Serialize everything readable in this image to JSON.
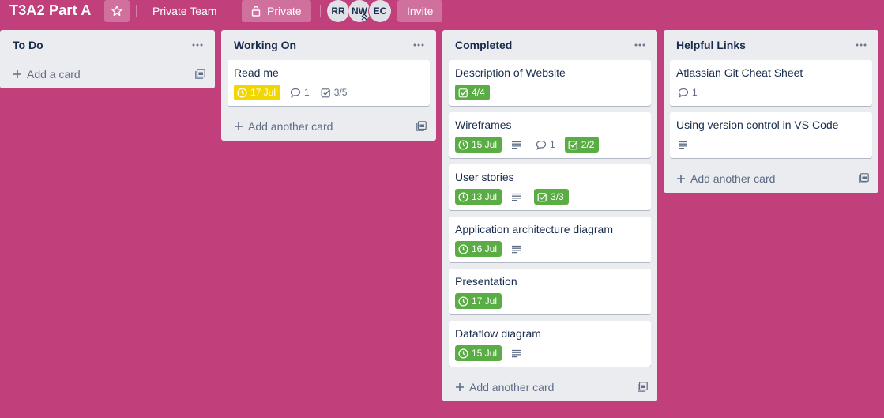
{
  "header": {
    "board_title": "T3A2 Part A",
    "team_label": "Private Team",
    "visibility_label": "Private",
    "invite_label": "Invite",
    "members": [
      "RR",
      "NW",
      "EC"
    ]
  },
  "colors": {
    "board_background": "#c1407c",
    "list_background": "#ebecf0",
    "due_green": "#5aac44",
    "due_yellow": "#f2d600"
  },
  "lists": [
    {
      "title": "To Do",
      "add_label": "Add a card",
      "cards": []
    },
    {
      "title": "Working On",
      "add_label": "Add another card",
      "cards": [
        {
          "title": "Read me",
          "due": "17 Jul",
          "due_status": "yellow",
          "description": false,
          "comments": "1",
          "checklist": "3/5",
          "checklist_complete": false
        }
      ]
    },
    {
      "title": "Completed",
      "add_label": "Add another card",
      "cards": [
        {
          "title": "Description of Website",
          "due": null,
          "description": false,
          "comments": null,
          "checklist": "4/4",
          "checklist_complete": true
        },
        {
          "title": "Wireframes",
          "due": "15 Jul",
          "due_status": "green",
          "description": true,
          "comments": "1",
          "checklist": "2/2",
          "checklist_complete": true
        },
        {
          "title": "User stories",
          "due": "13 Jul",
          "due_status": "green",
          "description": true,
          "comments": null,
          "checklist": "3/3",
          "checklist_complete": true
        },
        {
          "title": "Application architecture diagram",
          "due": "16 Jul",
          "due_status": "green",
          "description": true,
          "comments": null,
          "checklist": null
        },
        {
          "title": "Presentation",
          "due": "17 Jul",
          "due_status": "green",
          "description": false,
          "comments": null,
          "checklist": null
        },
        {
          "title": "Dataflow diagram",
          "due": "15 Jul",
          "due_status": "green",
          "description": true,
          "comments": null,
          "checklist": null
        }
      ]
    },
    {
      "title": "Helpful Links",
      "add_label": "Add another card",
      "cards": [
        {
          "title": "Atlassian Git Cheat Sheet",
          "due": null,
          "description": false,
          "comments": "1",
          "checklist": null
        },
        {
          "title": "Using version control in VS Code",
          "due": null,
          "description": true,
          "comments": null,
          "checklist": null
        }
      ]
    }
  ]
}
